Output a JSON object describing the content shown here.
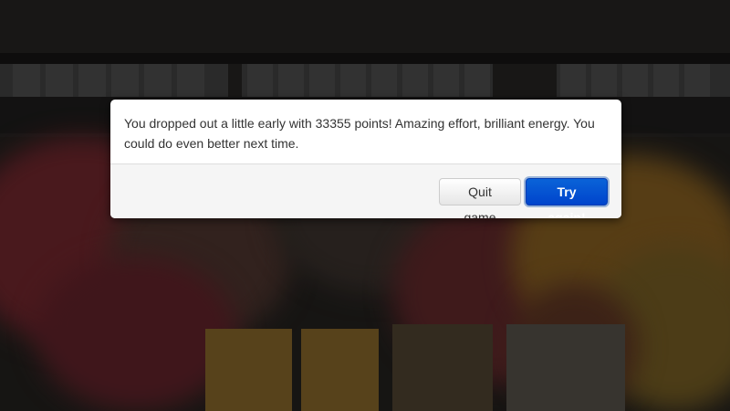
{
  "dialog": {
    "message": "You dropped out a little early with 33355 points! Amazing effort, brilliant energy. You could do even better next time.",
    "quit_label": "Quit game",
    "retry_label": "Try again!"
  },
  "background": {
    "description_icon": "temple-background-image"
  }
}
